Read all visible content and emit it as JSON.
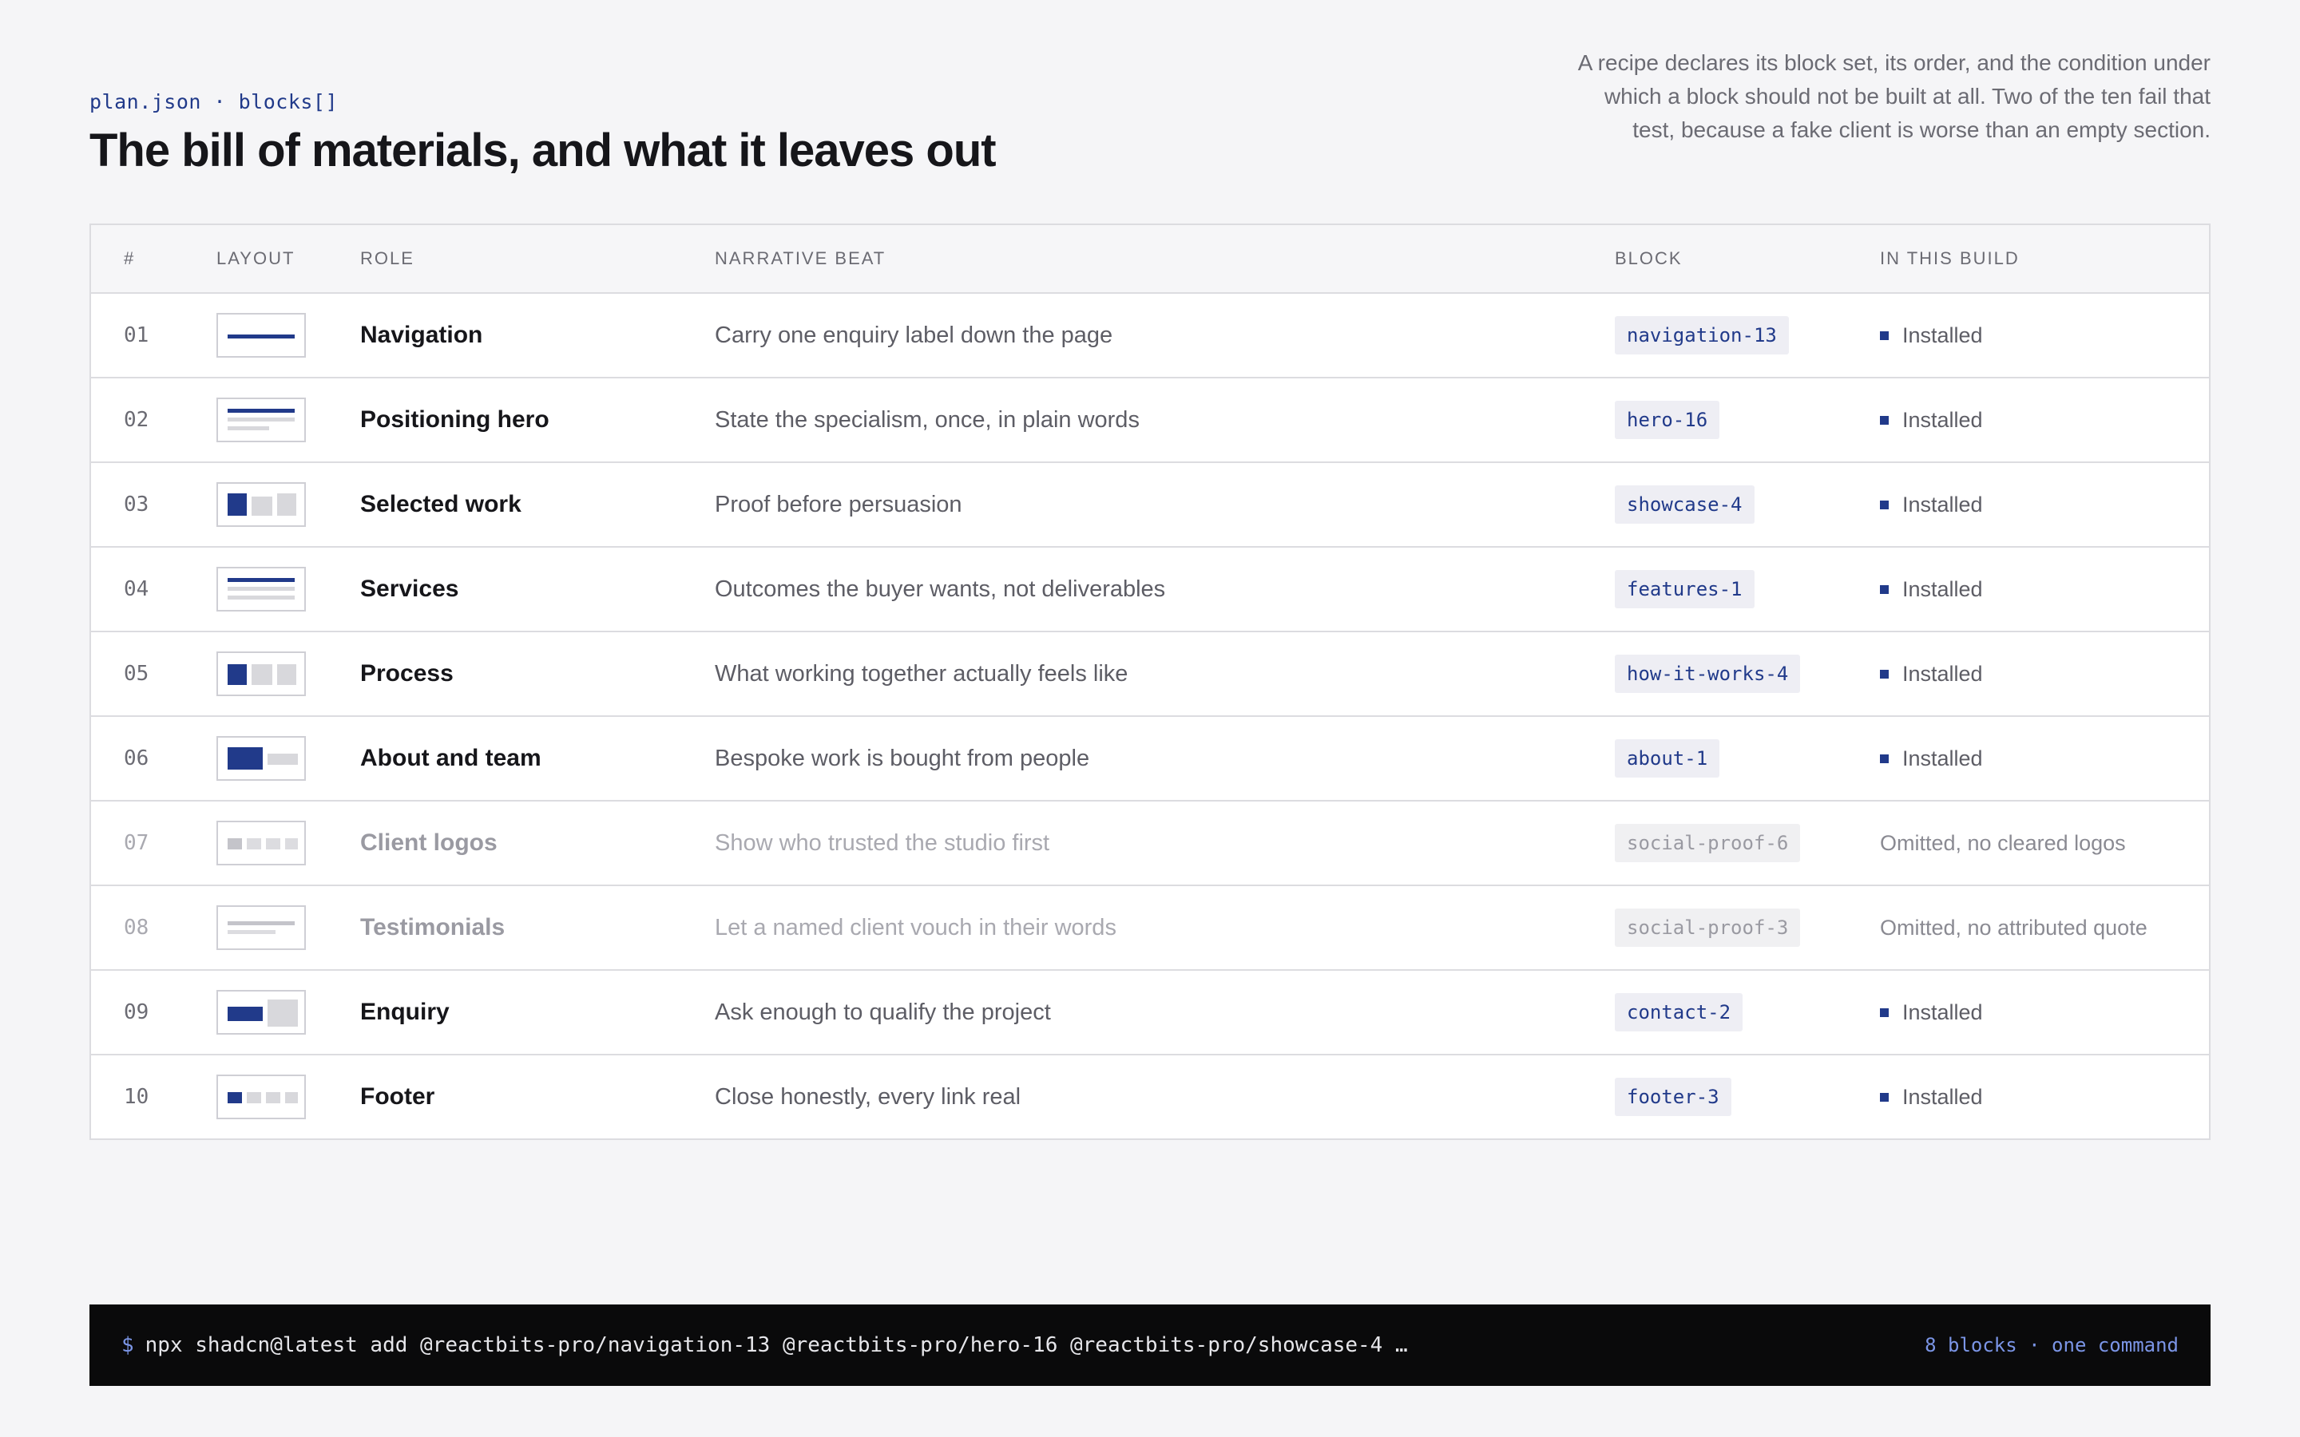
{
  "header": {
    "eyebrow": "plan.json · blocks[]",
    "title": "The bill of materials, and what it leaves out",
    "description": "A recipe declares its block set, its order, and the condition under which a block should not be built at all. Two of the ten fail that test, because a fake client is worse than an empty section."
  },
  "table": {
    "columns": [
      "#",
      "LAYOUT",
      "ROLE",
      "NARRATIVE BEAT",
      "BLOCK",
      "IN THIS BUILD"
    ],
    "rows": [
      {
        "num": "01",
        "layout_icon": "nav-bar-layout-icon",
        "role": "Navigation",
        "beat": "Carry one enquiry label down the page",
        "block": "navigation-13",
        "status": "Installed",
        "installed": true
      },
      {
        "num": "02",
        "layout_icon": "hero-lines-layout-icon",
        "role": "Positioning hero",
        "beat": "State the specialism, once, in plain words",
        "block": "hero-16",
        "status": "Installed",
        "installed": true
      },
      {
        "num": "03",
        "layout_icon": "three-tiles-layout-icon",
        "role": "Selected work",
        "beat": "Proof before persuasion",
        "block": "showcase-4",
        "status": "Installed",
        "installed": true
      },
      {
        "num": "04",
        "layout_icon": "stacked-lines-layout-icon",
        "role": "Services",
        "beat": "Outcomes the buyer wants, not deliverables",
        "block": "features-1",
        "status": "Installed",
        "installed": true
      },
      {
        "num": "05",
        "layout_icon": "three-tiles-layout-icon",
        "role": "Process",
        "beat": "What working together actually feels like",
        "block": "how-it-works-4",
        "status": "Installed",
        "installed": true
      },
      {
        "num": "06",
        "layout_icon": "image-text-layout-icon",
        "role": "About and team",
        "beat": "Bespoke work is bought from people",
        "block": "about-1",
        "status": "Installed",
        "installed": true
      },
      {
        "num": "07",
        "layout_icon": "logo-row-layout-icon",
        "role": "Client logos",
        "beat": "Show who trusted the studio first",
        "block": "social-proof-6",
        "status": "Omitted, no cleared logos",
        "installed": false
      },
      {
        "num": "08",
        "layout_icon": "quote-lines-layout-icon",
        "role": "Testimonials",
        "beat": "Let a named client vouch in their words",
        "block": "social-proof-3",
        "status": "Omitted, no attributed quote",
        "installed": false
      },
      {
        "num": "09",
        "layout_icon": "form-split-layout-icon",
        "role": "Enquiry",
        "beat": "Ask enough to qualify the project",
        "block": "contact-2",
        "status": "Installed",
        "installed": true
      },
      {
        "num": "10",
        "layout_icon": "footer-columns-layout-icon",
        "role": "Footer",
        "beat": "Close honestly, every link real",
        "block": "footer-3",
        "status": "Installed",
        "installed": true
      }
    ]
  },
  "terminal": {
    "prompt": "$",
    "command": "npx shadcn@latest add @reactbits-pro/navigation-13 @reactbits-pro/hero-16 @reactbits-pro/showcase-4 …",
    "summary": "8 blocks · one command"
  },
  "colors": {
    "accent": "#213a8a",
    "background": "#f5f5f7",
    "terminal_bg": "#0a0a0b",
    "terminal_accent": "#7b95e6"
  }
}
